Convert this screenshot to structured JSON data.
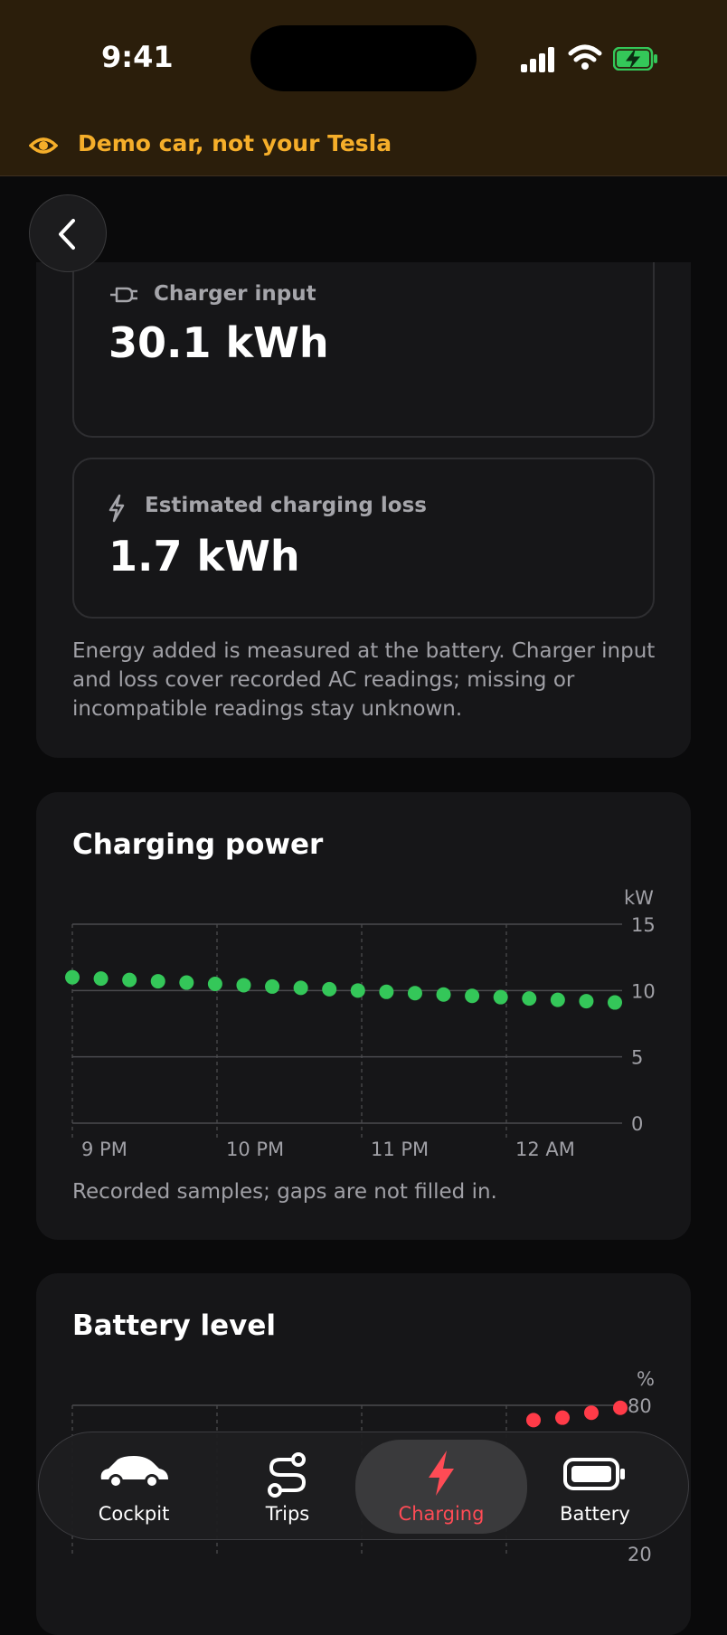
{
  "status_bar": {
    "time": "9:41"
  },
  "banner": {
    "text": "Demo car, not your Tesla",
    "accent_color": "#f5ae2a"
  },
  "energy": {
    "charger_input": {
      "label": "Charger input",
      "value": "30.1 kWh",
      "icon": "plug-icon"
    },
    "charging_loss": {
      "label": "Estimated charging loss",
      "value": "1.7 kWh",
      "icon": "bolt-icon"
    },
    "note": "Energy added is measured at the battery. Charger input and loss cover recorded AC readings; missing or incompatible readings stay unknown."
  },
  "charging_power": {
    "title": "Charging power",
    "note": "Recorded samples; gaps are not filled in.",
    "chart_data": {
      "type": "scatter",
      "title": "Charging power",
      "unit": "kW",
      "ylim": [
        0,
        15
      ],
      "y_ticks": [
        0,
        5,
        10,
        15
      ],
      "x_ticks": [
        "9 PM",
        "10 PM",
        "11 PM",
        "12 AM"
      ],
      "series": [
        {
          "color": "#34c759",
          "values": [
            11.0,
            10.9,
            10.8,
            10.7,
            10.6,
            10.5,
            10.4,
            10.3,
            10.2,
            10.1,
            10.0,
            9.9,
            9.8,
            9.7,
            9.6,
            9.5,
            9.4,
            9.3,
            9.2,
            9.1
          ]
        }
      ],
      "grid": true
    }
  },
  "battery_level": {
    "title": "Battery level",
    "chart_data": {
      "type": "scatter",
      "title": "Battery level",
      "unit": "%",
      "ylim": [
        20,
        80
      ],
      "y_ticks": [
        20,
        80
      ],
      "series": [
        {
          "color": "#ff3b48",
          "values": [
            79,
            77,
            75,
            74
          ]
        }
      ],
      "grid": true
    }
  },
  "tabs": [
    {
      "label": "Cockpit",
      "icon": "car-icon",
      "active": false
    },
    {
      "label": "Trips",
      "icon": "route-icon",
      "active": false
    },
    {
      "label": "Charging",
      "icon": "bolt-icon",
      "active": true
    },
    {
      "label": "Battery",
      "icon": "battery-icon",
      "active": false
    }
  ],
  "colors": {
    "active_tab": "#ff4b55",
    "power_series": "#34c759",
    "battery_series": "#ff3b48"
  }
}
